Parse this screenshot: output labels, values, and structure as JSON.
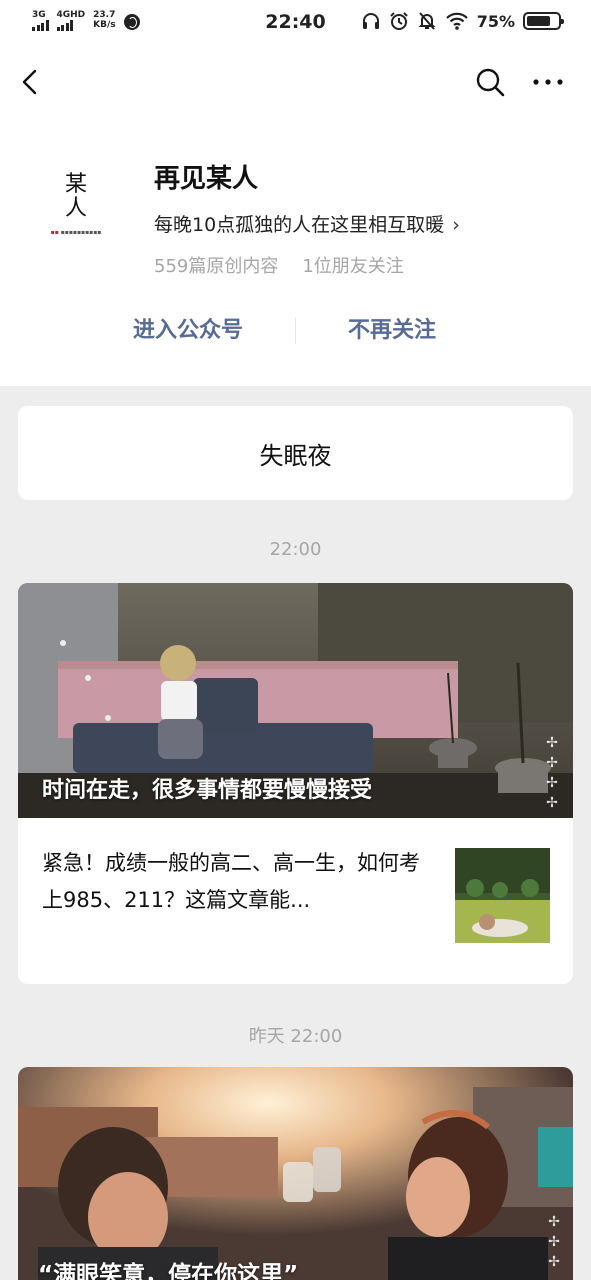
{
  "status_bar": {
    "net1": "3G",
    "net2": "4GHD",
    "speed_value": "23.7",
    "speed_unit": "KB/s",
    "time": "22:40",
    "battery_percent": "75%",
    "battery_level": 0.75
  },
  "nav": {
    "back_icon": "chevron-left-icon",
    "search_icon": "search-icon",
    "more_icon": "more-icon"
  },
  "account": {
    "logo_line1": "某",
    "logo_line2": "人",
    "name": "再见某人",
    "description": "每晚10点孤独的人在这里相互取暖",
    "original_count": "559篇原创内容",
    "friends_following": "1位朋友关注",
    "enter_label": "进入公众号",
    "unfollow_label": "不再关注"
  },
  "feed": {
    "pinned_title": "失眠夜",
    "group1_time": "22:00",
    "group1_cover_title": "时间在走，很多事情都要慢慢接受",
    "group1_sub_title": "紧急！成绩一般的高二、高一生，如何考上985、211？这篇文章能...",
    "group2_time": "昨天 22:00",
    "group2_cover_title": "“满眼笑意，停在你这里”"
  },
  "colors": {
    "link": "#576b95",
    "meta": "#a6a6a6",
    "background": "#ededed"
  }
}
